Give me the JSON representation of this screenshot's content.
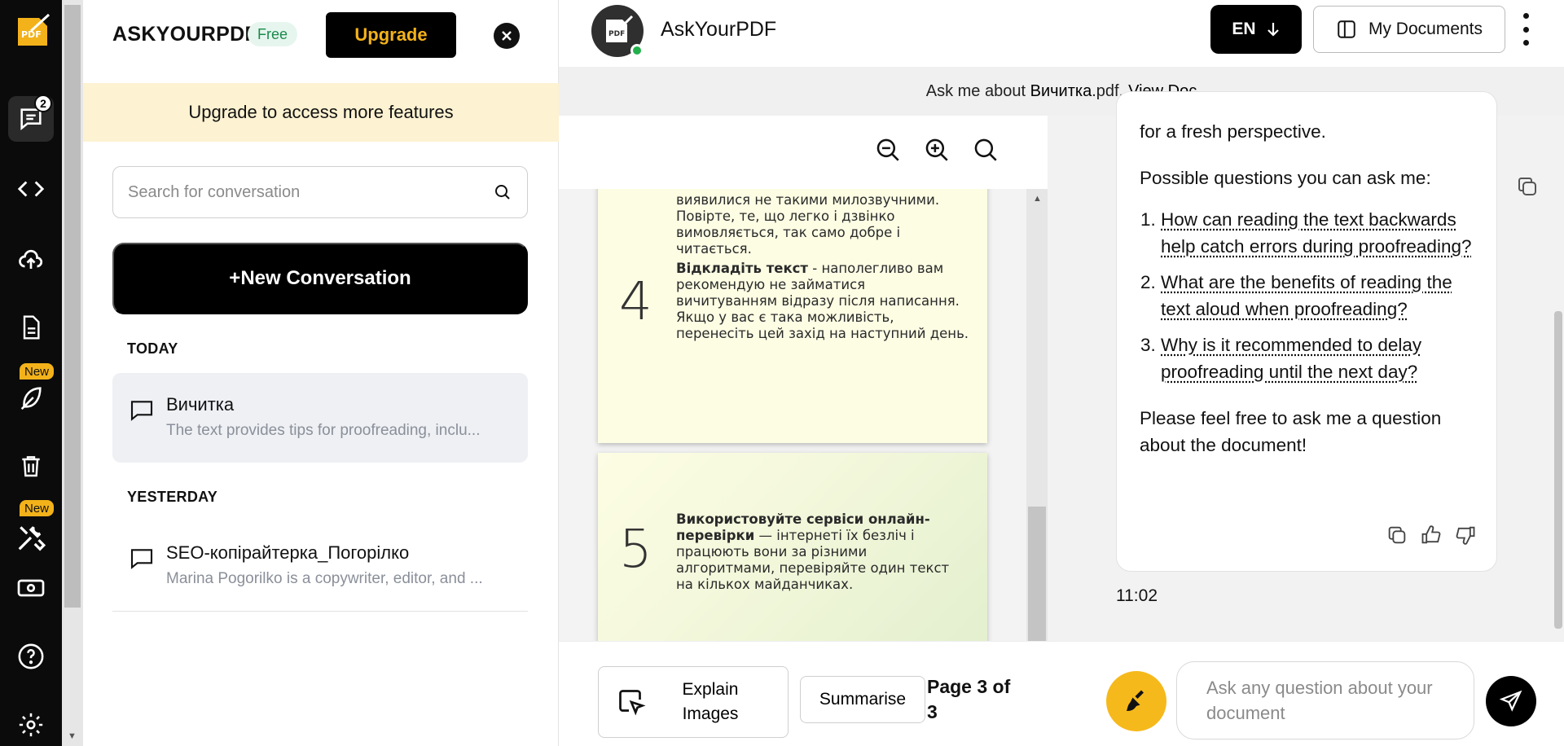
{
  "rail": {
    "chat_badge": "2",
    "new_tag_1": "New",
    "new_tag_2": "New"
  },
  "panel": {
    "brand": "ASKYOURPDF",
    "plan_badge": "Free",
    "upgrade_label": "Upgrade",
    "upgrade_banner": "Upgrade to access more features",
    "search_placeholder": "Search for conversation",
    "new_conversation_label": "+New Conversation",
    "sections": {
      "today": "TODAY",
      "yesterday": "YESTERDAY"
    },
    "conversations": [
      {
        "title": "Вичитка",
        "summary": "The text provides tips for proofreading, inclu..."
      },
      {
        "title": "SEO-копірайтерка_Погорілко",
        "summary": "Marina Pogorilko is a copywriter, editor, and ..."
      }
    ]
  },
  "header": {
    "app_title": "AskYourPDF",
    "language": "EN",
    "my_documents": "My Documents"
  },
  "askbar": {
    "prefix": "Ask me about",
    "doc_name": "Вичитка",
    "doc_ext": ".pdf.",
    "view_doc": "View Doc"
  },
  "viewer": {
    "pages": [
      {
        "text_top": "виявилися не такими милозвучними. Повірте, те, що легко і дзвінко вимовляється, так само добре і читається."
      },
      {
        "number": "4",
        "bold": "Відкладіть текст",
        "text": " - наполегливо вам рекомендую не займатися вичитуванням відразу після написання. Якщо у вас є така можливість, перенесіть цей захід на наступний день."
      },
      {
        "number": "5",
        "bold": "Використовуйте сервіси онлайн-перевірки",
        "text": " — інтернеті їх безліч і працюють вони за різними алгоритмами, перевіряйте один текст на кількох майданчиках."
      }
    ]
  },
  "chat": {
    "intro_tail": "for a fresh perspective.",
    "questions_heading": "Possible questions you can ask me:",
    "questions": [
      "How can reading the text backwards help catch errors during proofreading?",
      "What are the benefits of reading the text aloud when proofreading?",
      "Why is it recommended to delay proofreading until the next day?"
    ],
    "closing": "Please feel free to ask me a question about the document!",
    "timestamp": "11:02"
  },
  "bottombar": {
    "explain_images": "Explain Images",
    "summarise": "Summarise",
    "page_info": "Page 3 of 3",
    "ask_placeholder": "Ask any question about your document"
  },
  "colors": {
    "accent": "#f3b21a",
    "rail_bg": "#0b0b0b",
    "page_bg": "#fdfde4",
    "online": "#23b04c"
  }
}
